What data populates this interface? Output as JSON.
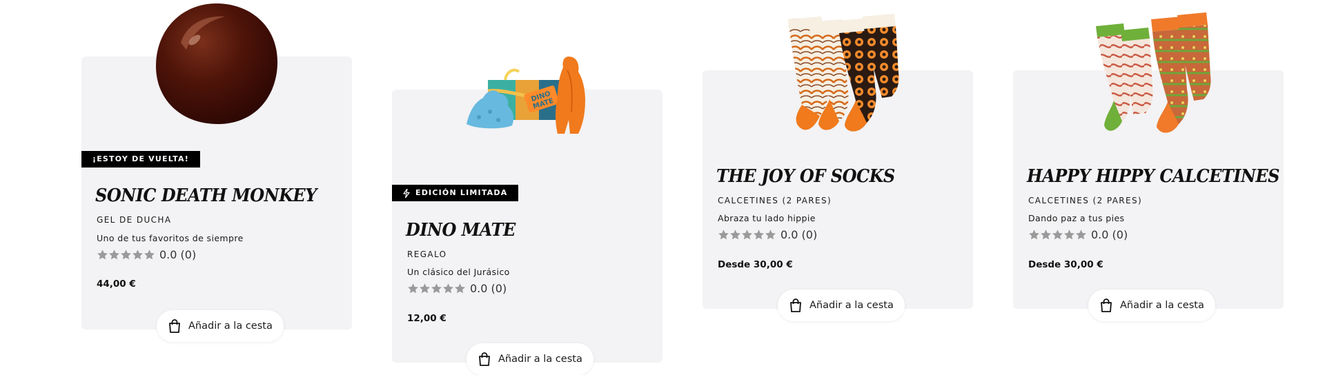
{
  "products": [
    {
      "badge": "¡ESTOY DE VUELTA!",
      "title": "SONIC DEATH MONKEY",
      "category": "GEL DE DUCHA",
      "tagline": "Uno de tus favoritos de siempre",
      "rating": "0.0 (0)",
      "price": "44,00 €",
      "button_label": "Añadir a la cesta",
      "image_icon": "shower-gel-drop-image"
    },
    {
      "badge": "EDICIÓN LIMITADA",
      "badge_icon": "lightning-icon",
      "title": "DINO MATE",
      "category": "REGALO",
      "tagline": "Un clásico del Jurásico",
      "rating": "0.0 (0)",
      "price": "12,00 €",
      "button_label": "Añadir a la cesta",
      "image_icon": "dino-gift-box-image"
    },
    {
      "title": "THE JOY OF SOCKS",
      "category": "CALCETINES (2 PARES)",
      "tagline": "Abraza tu lado hippie",
      "rating": "0.0 (0)",
      "price": "Desde 30,00 €",
      "button_label": "Añadir a la cesta",
      "image_icon": "orange-socks-image"
    },
    {
      "title": "HAPPY HIPPY CALCETINES",
      "category": "CALCETINES (2 PARES)",
      "tagline": "Dando paz a tus pies",
      "rating": "0.0 (0)",
      "price": "Desde 30,00 €",
      "button_label": "Añadir a la cesta",
      "image_icon": "green-socks-image"
    }
  ],
  "colors": {
    "card_background": "#f3f2f4",
    "badge_background": "#000000",
    "star_empty": "#9a9a9a"
  }
}
